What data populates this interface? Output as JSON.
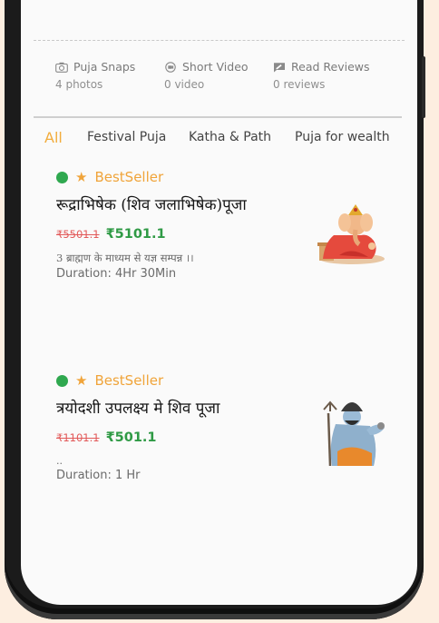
{
  "stats": [
    {
      "label": "Puja Snaps",
      "sub": "4 photos",
      "icon": "camera-icon"
    },
    {
      "label": "Short Video",
      "sub": "0 video",
      "icon": "video-icon"
    },
    {
      "label": "Read Reviews",
      "sub": "0 reviews",
      "icon": "review-icon"
    }
  ],
  "tabs": [
    "All",
    "Festival Puja",
    "Katha & Path",
    "Puja for wealth"
  ],
  "accent_color": "#f2ac3c",
  "items": [
    {
      "badge": "BestSeller",
      "title": "रूद्राभिषेक (शिव जलाभिषेक)पूजा",
      "old_price": "₹5501.1",
      "new_price": "₹5101.1",
      "desc1": "3 ब्राह्मण के माध्यम से यज्ञ सम्पन्न ।।",
      "desc2": "Duration: 4Hr 30Min",
      "image": "ganesha-image"
    },
    {
      "badge": "BestSeller",
      "title": "त्रयोदशी उपलक्ष्य मे शिव पूजा",
      "old_price": "₹1101.1",
      "new_price": "₹501.1",
      "desc1": "..",
      "desc2": "Duration: 1 Hr",
      "image": "shiva-image"
    }
  ]
}
